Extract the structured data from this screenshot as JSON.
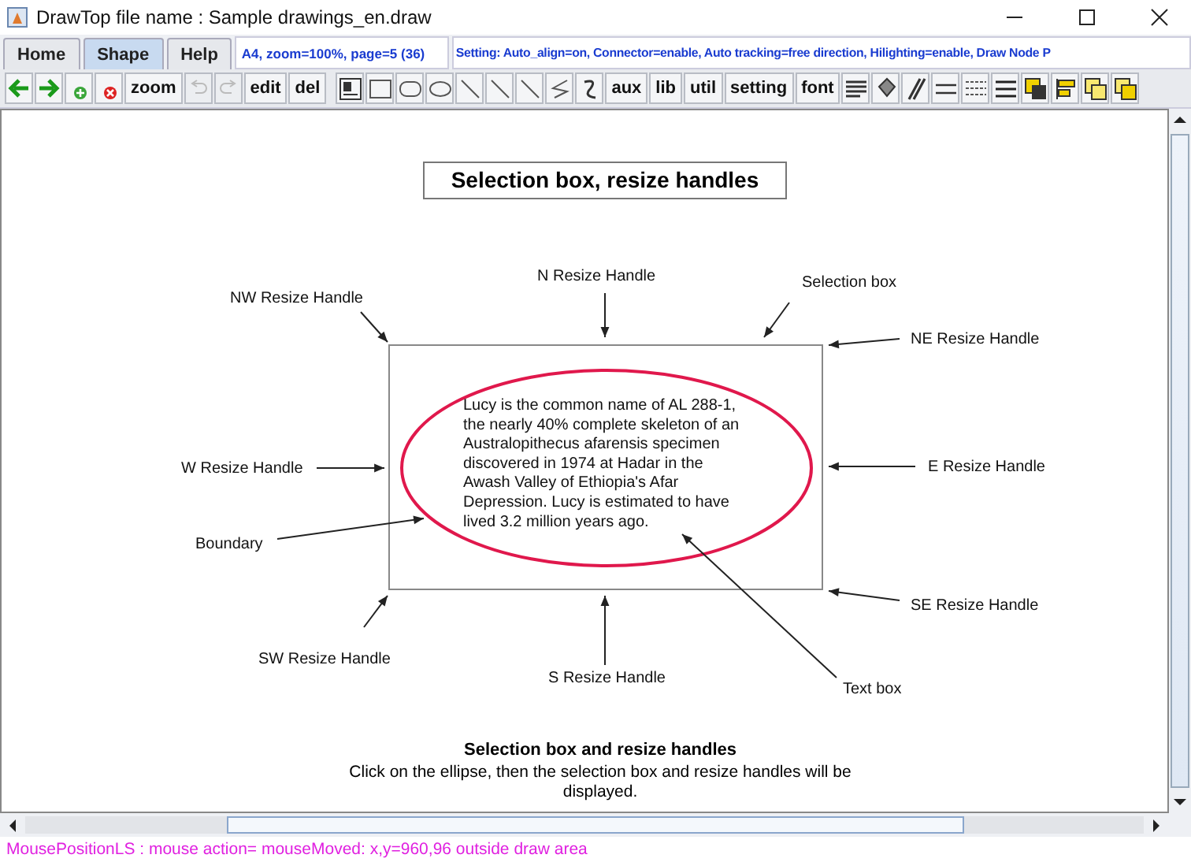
{
  "window": {
    "title": "DrawTop file name : Sample drawings_en.draw"
  },
  "tabs": [
    {
      "label": "Home",
      "selected": false
    },
    {
      "label": "Shape",
      "selected": true
    },
    {
      "label": "Help",
      "selected": false
    }
  ],
  "page_info": "A4,  zoom=100%,  page=5 (36)",
  "settings_info": "Setting:  Auto_align=on,  Connector=enable,  Auto tracking=free direction,  Hilighting=enable,  Draw Node P",
  "toolbar": {
    "buttons": [
      "zoom",
      "edit",
      "del",
      "aux",
      "lib",
      "util",
      "setting",
      "font"
    ]
  },
  "drawing": {
    "title": "Selection box, resize handles",
    "text_box": [
      "Lucy is the common name of AL 288-1,",
      "the nearly 40% complete skeleton of an",
      "Australopithecus afarensis specimen",
      "discovered in 1974 at Hadar in the",
      "Awash Valley of Ethiopia's Afar",
      "Depression. Lucy is estimated to have",
      "lived 3.2 million years ago."
    ],
    "annotations": [
      "NW Resize Handle",
      "N Resize Handle",
      "Selection box",
      "NE Resize Handle",
      "W Resize Handle",
      "E Resize Handle",
      "Boundary",
      "SW Resize Handle",
      "S Resize Handle",
      "SE Resize Handle",
      "Text box"
    ],
    "caption_title": "Selection box and resize handles",
    "caption_text": [
      "Click on the ellipse, then the selection box and resize handles will be",
      "displayed."
    ]
  },
  "status_bar": "MousePositionLS :  mouse action= mouseMoved:   x,y=960,96 outside draw area"
}
